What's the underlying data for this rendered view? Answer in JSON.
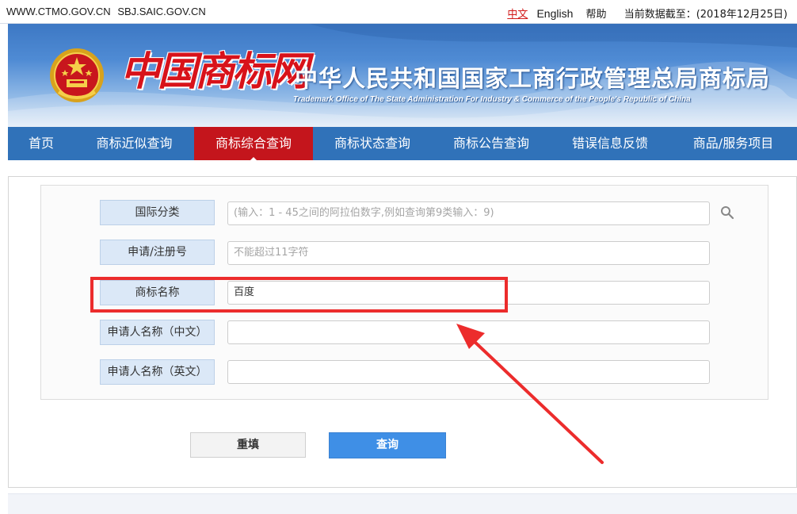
{
  "topbar": {
    "urls": [
      "WWW.CTMO.GOV.CN",
      "SBJ.SAIC.GOV.CN"
    ],
    "lang_zh": "中文",
    "lang_en": "English",
    "help": "帮助",
    "date_label": "当前数据截至：(2018年12月25日)"
  },
  "header": {
    "logo_text": "中国商标网",
    "title_cn": "中华人民共和国国家工商行政管理总局商标局",
    "title_en": "Trademark Office of The State Administration For Industry & Commerce of the People's Republic of China"
  },
  "nav": {
    "items": [
      "首页",
      "商标近似查询",
      "商标综合查询",
      "商标状态查询",
      "商标公告查询",
      "错误信息反馈",
      "商品/服务项目"
    ],
    "active_index": 2
  },
  "form": {
    "rows": [
      {
        "label": "国际分类",
        "value": "",
        "placeholder": "(输入：1 - 45之间的阿拉伯数字,例如查询第9类输入：9)"
      },
      {
        "label": "申请/注册号",
        "value": "",
        "placeholder": "不能超过11字符"
      },
      {
        "label": "商标名称",
        "value": "百度",
        "placeholder": ""
      },
      {
        "label": "申请人名称（中文）",
        "value": "",
        "placeholder": ""
      },
      {
        "label": "申请人名称（英文）",
        "value": "",
        "placeholder": ""
      }
    ],
    "reset_label": "重填",
    "search_label": "查询"
  },
  "colors": {
    "nav_bg": "#3072b9",
    "nav_active": "#c4151c",
    "annotation_red": "#ec2c2c",
    "search_button": "#3f8fe6"
  }
}
